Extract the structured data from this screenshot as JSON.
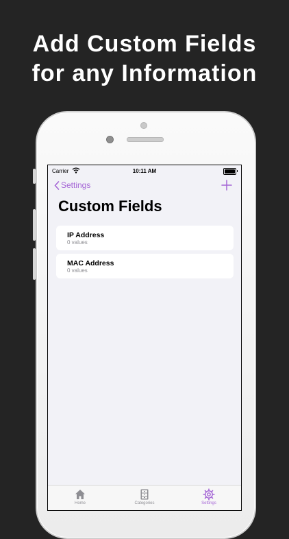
{
  "headline": {
    "line1": "Add Custom Fields",
    "line2": "for any Information"
  },
  "status_bar": {
    "carrier": "Carrier",
    "time": "10:11 AM"
  },
  "nav": {
    "back_label": "Settings",
    "add_icon": "plus-icon"
  },
  "page": {
    "title": "Custom Fields"
  },
  "fields": [
    {
      "name": "IP Address",
      "count": "0 values"
    },
    {
      "name": "MAC Address",
      "count": "0 values"
    }
  ],
  "tab_bar": {
    "items": [
      {
        "label": "Home",
        "icon": "house-icon",
        "active": false
      },
      {
        "label": "Categories",
        "icon": "cabinet-icon",
        "active": false
      },
      {
        "label": "Settings",
        "icon": "gear-icon",
        "active": true
      }
    ]
  },
  "colors": {
    "accent": "#a566d6",
    "background": "#242424",
    "screen_background": "#f2f2f7"
  }
}
